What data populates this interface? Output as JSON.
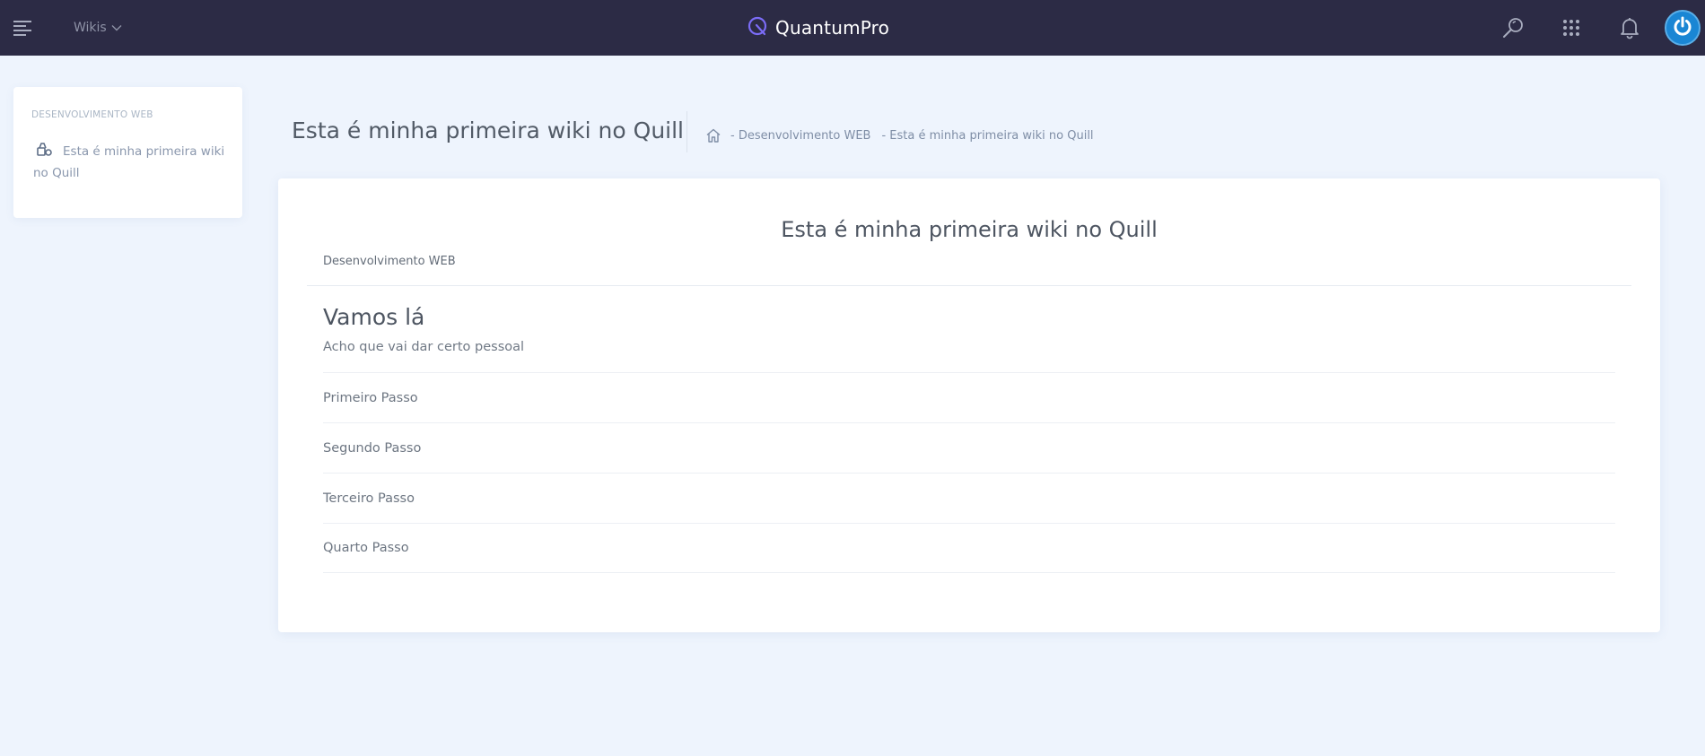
{
  "header": {
    "wikis_label": "Wikis",
    "brand_name": "QuantumPro",
    "accent_color": "#7b6cf6",
    "icons": [
      "menu-icon",
      "chevron-down-icon",
      "search-icon",
      "apps-grid-icon",
      "bell-icon",
      "power-icon"
    ]
  },
  "sidebar": {
    "heading": "DESENVOLVIMENTO WEB",
    "items": [
      {
        "label": "Esta é minha primeira wiki no Quill",
        "icon": "wiki-icon"
      }
    ]
  },
  "page": {
    "title": "Esta é minha primeira wiki no Quill",
    "breadcrumb": [
      {
        "label": "- Desenvolvimento WEB"
      },
      {
        "label": "- Esta é minha primeira wiki no Quill"
      }
    ]
  },
  "document": {
    "title": "Esta é minha primeira wiki no Quill",
    "category": "Desenvolvimento WEB",
    "section_heading": "Vamos lá",
    "section_text": "Acho que vai dar certo pessoal",
    "steps": [
      "Primeiro Passo",
      "Segundo Passo",
      "Terceiro Passo",
      "Quarto Passo"
    ]
  }
}
